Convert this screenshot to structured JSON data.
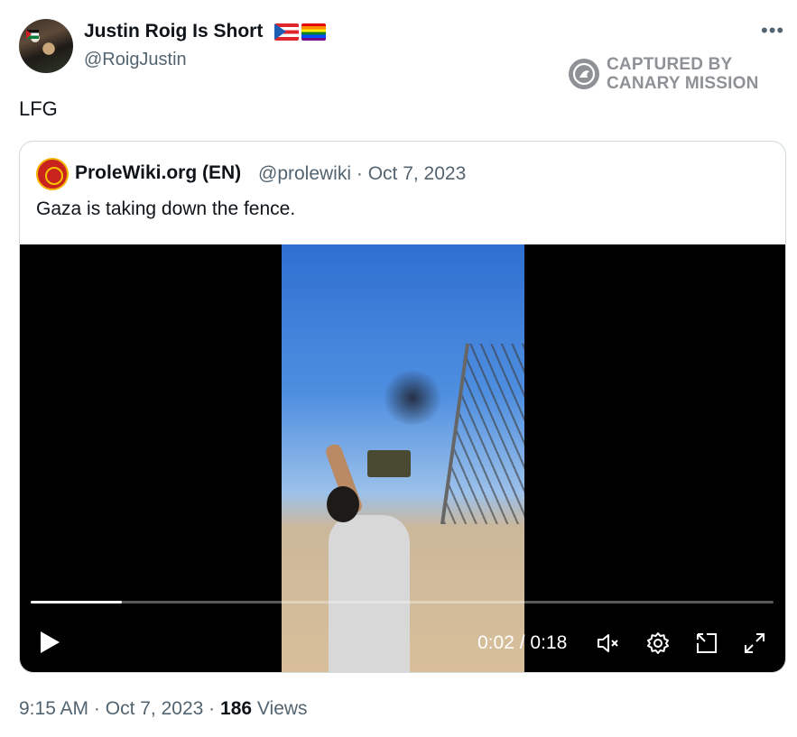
{
  "author": {
    "display_name": "Justin Roig Is Short",
    "handle": "@RoigJustin",
    "flag_icons": [
      "puerto-rico-flag-icon",
      "rainbow-flag-icon"
    ]
  },
  "tweet": {
    "text": "LFG",
    "time": "9:15 AM",
    "sep1": "·",
    "date": "Oct 7, 2023",
    "sep2": "·",
    "views_count": "186",
    "views_label": "Views"
  },
  "watermark": {
    "line1": "CAPTURED BY",
    "line2": "CANARY MISSION"
  },
  "quoted_tweet": {
    "display_name": "ProleWiki.org (EN)",
    "handle": "@prolewiki",
    "sep": "·",
    "date": "Oct 7, 2023",
    "text": "Gaza is taking down the fence."
  },
  "video": {
    "current_time": "0:02",
    "time_sep": "/",
    "duration": "0:18",
    "progress_fraction": 0.123
  },
  "colors": {
    "primary_text": "#0f1419",
    "secondary_text": "#536471",
    "border": "#cfd9de",
    "watermark": "#8e9296"
  }
}
